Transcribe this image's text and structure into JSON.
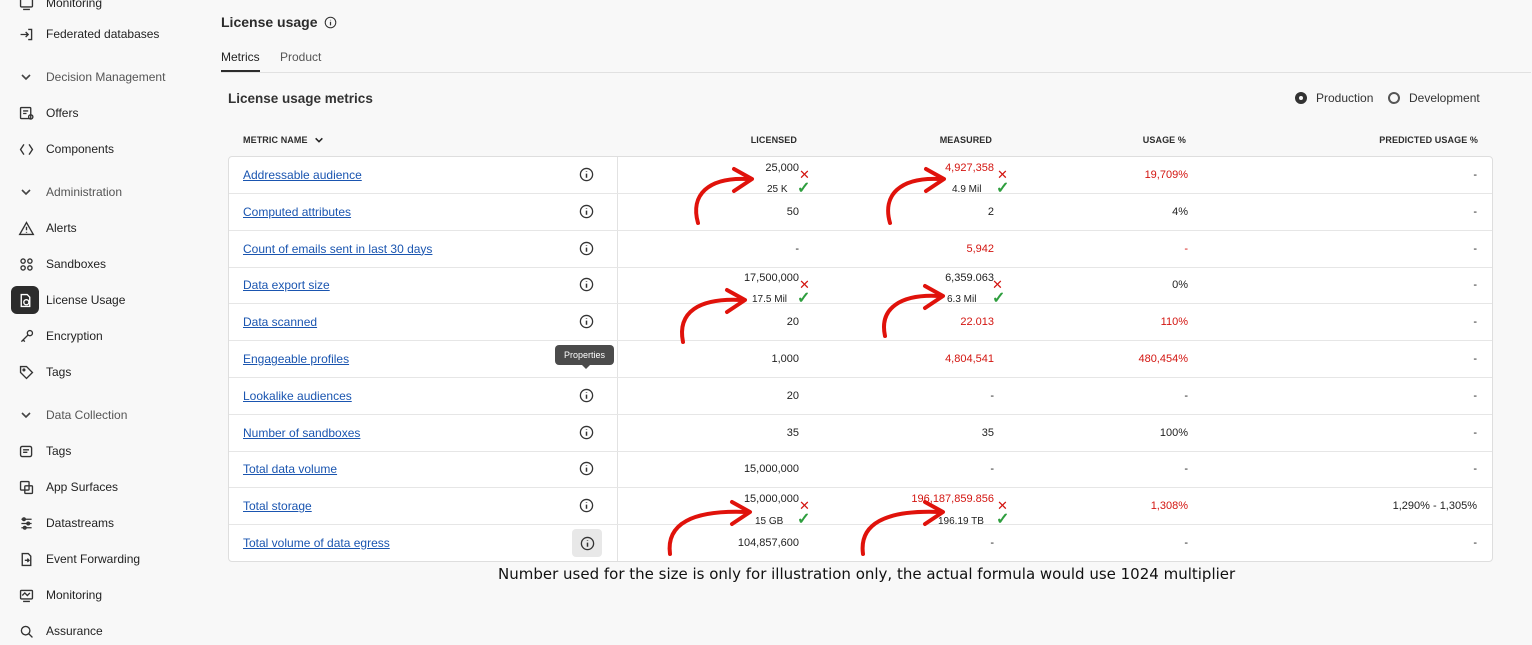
{
  "sidebar": {
    "top_partial": "Monitoring",
    "items": [
      {
        "label": "Federated databases",
        "icon": "import-icon"
      },
      {
        "label": "Offers",
        "icon": "offers-icon"
      },
      {
        "label": "Components",
        "icon": "components-icon"
      },
      {
        "label": "Alerts",
        "icon": "alert-icon"
      },
      {
        "label": "Sandboxes",
        "icon": "sandbox-icon"
      },
      {
        "label": "License Usage",
        "icon": "license-icon"
      },
      {
        "label": "Encryption",
        "icon": "key-icon"
      },
      {
        "label": "Tags",
        "icon": "tag-icon"
      },
      {
        "label": "Tags",
        "icon": "tags-icon"
      },
      {
        "label": "App Surfaces",
        "icon": "app-surfaces-icon"
      },
      {
        "label": "Datastreams",
        "icon": "datastreams-icon"
      },
      {
        "label": "Event Forwarding",
        "icon": "event-forwarding-icon"
      },
      {
        "label": "Monitoring",
        "icon": "monitoring-icon"
      },
      {
        "label": "Assurance",
        "icon": "assurance-icon"
      }
    ],
    "sections": [
      "Decision Management",
      "Administration",
      "Data Collection"
    ]
  },
  "header": {
    "title": "License usage",
    "tabs": [
      "Metrics",
      "Product"
    ]
  },
  "card": {
    "title": "License usage metrics",
    "radio_production": "Production",
    "radio_development": "Development"
  },
  "table": {
    "columns": [
      "METRIC NAME",
      "LICENSED",
      "MEASURED",
      "USAGE %",
      "PREDICTED USAGE %"
    ],
    "rows": [
      {
        "name": "Addressable audience",
        "licensed": "25,000",
        "measured": "4,927,358",
        "usage": "19,709%",
        "predicted": "-"
      },
      {
        "name": "Computed attributes",
        "licensed": "50",
        "measured": "2",
        "usage": "4%",
        "predicted": "-"
      },
      {
        "name": "Count of emails sent in last 30 days",
        "licensed": "-",
        "measured": "5,942",
        "usage": "-",
        "predicted": "-"
      },
      {
        "name": "Data export size",
        "licensed": "17,500,000",
        "measured": "6,359.063",
        "usage": "0%",
        "predicted": "-"
      },
      {
        "name": "Data scanned",
        "licensed": "20",
        "measured": "22.013",
        "usage": "110%",
        "predicted": "-"
      },
      {
        "name": "Engageable profiles",
        "licensed": "1,000",
        "measured": "4,804,541",
        "usage": "480,454%",
        "predicted": "-"
      },
      {
        "name": "Lookalike audiences",
        "licensed": "20",
        "measured": "-",
        "usage": "-",
        "predicted": "-"
      },
      {
        "name": "Number of sandboxes",
        "licensed": "35",
        "measured": "35",
        "usage": "100%",
        "predicted": "-"
      },
      {
        "name": "Total data volume",
        "licensed": "15,000,000",
        "measured": "-",
        "usage": "-",
        "predicted": "-"
      },
      {
        "name": "Total storage",
        "licensed": "15,000,000",
        "measured": "196,187,859.856",
        "usage": "1,308%",
        "predicted": "1,290% - 1,305%"
      },
      {
        "name": "Total volume of data egress",
        "licensed": "104,857,600",
        "measured": "-",
        "usage": "-",
        "predicted": "-"
      }
    ]
  },
  "annotations": {
    "row0_licensed": "25 K",
    "row0_measured": "4.9 Mil",
    "row3_licensed": "17.5 Mil",
    "row3_measured": "6.3 Mil",
    "row9_licensed": "15 GB",
    "row9_measured": "196.19 TB",
    "wrong_mark": "✕",
    "right_mark": "✓"
  },
  "tooltip": "Properties",
  "footnote": "Number used for the size is only for illustration only, the actual formula would use 1024 multiplier",
  "colors": {
    "link": "#1a55b0",
    "over_limit": "#d31510",
    "ok": "#2e9e3e",
    "annotation_arrow": "#e0120b"
  }
}
